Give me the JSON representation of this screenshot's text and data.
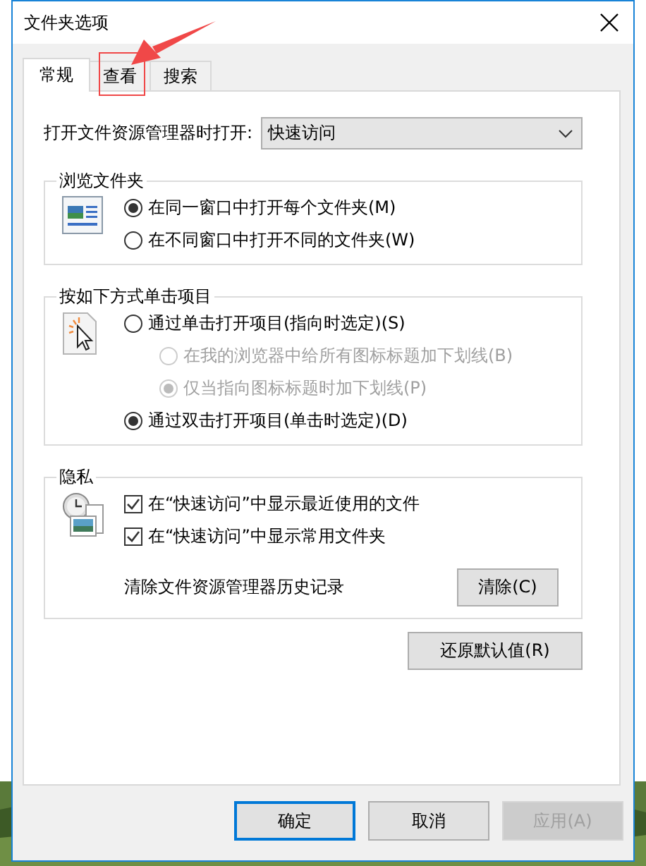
{
  "window": {
    "title": "文件夹选项"
  },
  "tabs": [
    {
      "label": "常规",
      "selected": true
    },
    {
      "label": "查看",
      "selected": false
    },
    {
      "label": "搜索",
      "selected": false
    }
  ],
  "open_in": {
    "label": "打开文件资源管理器时打开:",
    "value": "快速访问"
  },
  "groups": [
    {
      "title": "浏览文件夹",
      "options": [
        {
          "kind": "radio",
          "label": "在同一窗口中打开每个文件夹(M)",
          "selected": true,
          "disabled": false
        },
        {
          "kind": "radio",
          "label": "在不同窗口中打开不同的文件夹(W)",
          "selected": false,
          "disabled": false
        }
      ]
    },
    {
      "title": "按如下方式单击项目",
      "options": [
        {
          "kind": "radio",
          "label": "通过单击打开项目(指向时选定)(S)",
          "selected": false,
          "disabled": false,
          "children": [
            {
              "kind": "radio",
              "label": "在我的浏览器中给所有图标标题加下划线(B)",
              "selected": false,
              "disabled": true
            },
            {
              "kind": "radio",
              "label": "仅当指向图标标题时加下划线(P)",
              "selected": true,
              "disabled": true
            }
          ]
        },
        {
          "kind": "radio",
          "label": "通过双击打开项目(单击时选定)(D)",
          "selected": true,
          "disabled": false
        }
      ]
    },
    {
      "title": "隐私",
      "options": [
        {
          "kind": "checkbox",
          "label": "在“快速访问”中显示最近使用的文件",
          "checked": true,
          "disabled": false
        },
        {
          "kind": "checkbox",
          "label": "在“快速访问”中显示常用文件夹",
          "checked": true,
          "disabled": false
        },
        {
          "kind": "action",
          "label": "清除文件资源管理器历史记录",
          "button": "清除(C)"
        }
      ]
    }
  ],
  "restore_button": "还原默认值(R)",
  "buttons": [
    {
      "label": "确定",
      "default": true,
      "disabled": false
    },
    {
      "label": "取消",
      "default": false,
      "disabled": false
    },
    {
      "label": "应用(A)",
      "default": false,
      "disabled": true
    }
  ],
  "annotation": {
    "kind": "arrow-box"
  }
}
